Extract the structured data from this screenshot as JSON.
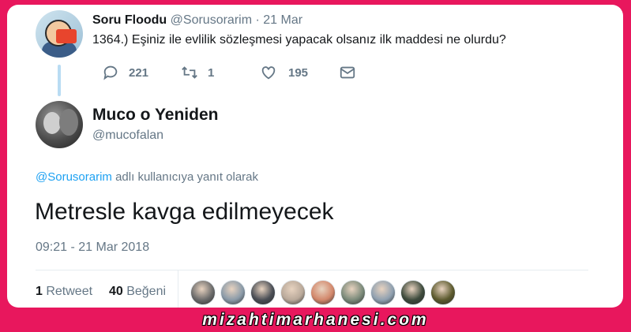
{
  "parent_tweet": {
    "name": "Soru Floodu",
    "handle": "@Sorusorarim",
    "separator": "·",
    "date": "21 Mar",
    "text": "1364.) Eşiniz ile evlilik sözleşmesi yapacak olsanız ilk maddesi ne olurdu?",
    "actions": {
      "reply_icon": "reply-icon",
      "reply_count": "221",
      "retweet_icon": "retweet-icon",
      "retweet_count": "1",
      "like_icon": "heart-icon",
      "like_count": "195",
      "dm_icon": "envelope-icon"
    }
  },
  "main_tweet": {
    "name": "Muco o Yeniden",
    "handle": "@mucofalan",
    "reply_mention": "@Sorusorarim",
    "reply_suffix": " adlı kullanıcıya yanıt olarak",
    "text": "Metresle kavga edilmeyecek",
    "timestamp": "09:21 - 21 Mar 2018",
    "retweet_count": "1",
    "retweet_label": " Retweet",
    "like_count": "40",
    "like_label": " Beğeni"
  },
  "liker_colors": [
    "#6b6b6b",
    "#8a9aa8",
    "#4a4e55",
    "#b9a99a",
    "#d2876b",
    "#7b8a7a",
    "#8fa0b0",
    "#3d4a3c",
    "#5c5a2e"
  ],
  "footer_text": "mizahtimarhanesi.com",
  "colors": {
    "background": "#e8175d",
    "link": "#1da1f2",
    "muted": "#657786",
    "text": "#14171a"
  }
}
